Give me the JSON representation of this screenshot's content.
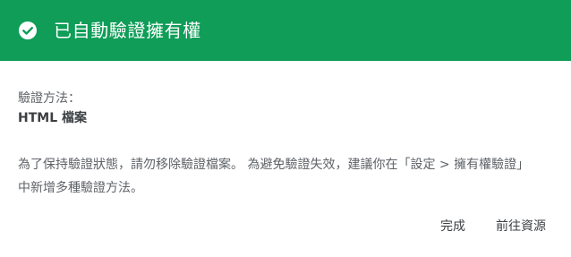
{
  "header": {
    "icon": "check-circle-icon",
    "title": "已自動驗證擁有權",
    "background_color": "#0f9d58"
  },
  "details": {
    "method_label": "驗證方法：",
    "method_value": "HTML 檔案"
  },
  "message": "為了保持驗證狀態，請勿移除驗證檔案。 為避免驗證失效，建議你在「設定 > 擁有權驗證」中新增多種驗證方法。",
  "actions": {
    "done_label": "完成",
    "go_to_property_label": "前往資源"
  }
}
